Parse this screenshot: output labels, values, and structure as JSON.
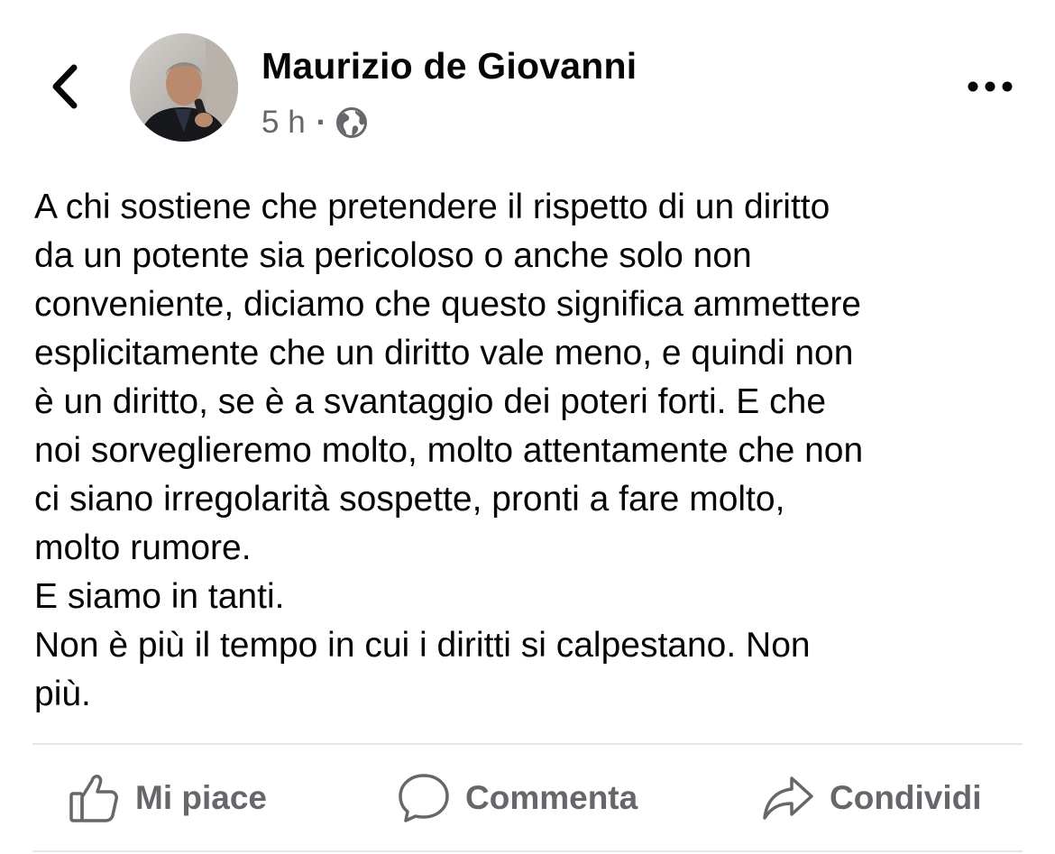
{
  "header": {
    "back_icon": "chevron-left-icon",
    "author_name": "Maurizio de Giovanni",
    "time": "5 h",
    "separator": "·",
    "privacy_icon": "globe-icon",
    "more_icon": "ellipsis-icon"
  },
  "post": {
    "lines": [
      "A chi sostiene che pretendere il rispetto di un diritto",
      "da un potente sia pericoloso o anche solo non",
      "conveniente, diciamo che questo significa ammettere",
      "esplicitamente che un diritto vale meno, e quindi non",
      "è un diritto, se è a svantaggio dei poteri forti. E che",
      "noi sorveglieremo molto, molto attentamente che non",
      "ci siano irregolarità sospette, pronti a fare molto,",
      "molto rumore.",
      "E siamo in tanti.",
      "Non è più il tempo in cui i diritti si calpestano. Non",
      "più."
    ]
  },
  "actions": {
    "like_label": "Mi piace",
    "comment_label": "Commenta",
    "share_label": "Condividi"
  },
  "colors": {
    "text": "#050505",
    "secondary": "#65676b",
    "divider": "#e4e6eb"
  }
}
